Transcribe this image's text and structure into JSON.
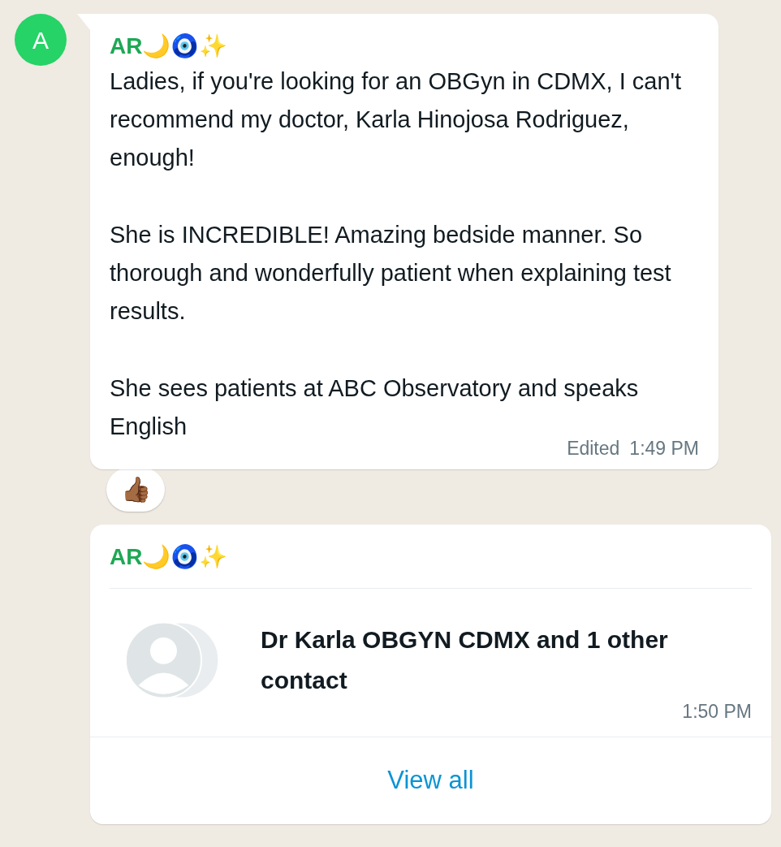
{
  "text_message": {
    "avatar": "A",
    "sender": "AR🌙🧿✨",
    "paragraphs": [
      "Ladies, if you're looking for an OBGyn in CDMX, I can't recommend my doctor, Karla Hinojosa Rodriguez, enough!",
      "She is INCREDIBLE! Amazing bedside manner. So thorough and wonderfully patient when explaining test results.",
      "She sees patients at ABC Observatory and speaks English"
    ],
    "edited": "Edited",
    "time": "1:49 PM",
    "reaction": "👍🏾"
  },
  "contact_message": {
    "sender": "AR🌙🧿✨",
    "contact_name": "Dr Karla OBGYN CDMX and 1 other contact",
    "time": "1:50 PM",
    "action": "View all"
  }
}
